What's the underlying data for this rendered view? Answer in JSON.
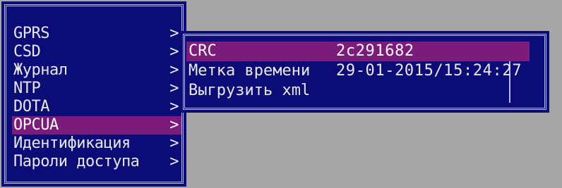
{
  "left_menu": {
    "items": [
      {
        "label": "GPRS",
        "arrow": ">"
      },
      {
        "label": "CSD",
        "arrow": ">"
      },
      {
        "label": "Журнал",
        "arrow": ">"
      },
      {
        "label": "NTP",
        "arrow": ">"
      },
      {
        "label": "DOTA",
        "arrow": ">"
      },
      {
        "label": "OPCUA",
        "arrow": ">"
      },
      {
        "label": "Идентификация",
        "arrow": ">"
      },
      {
        "label": "Пароли доступа",
        "arrow": ">"
      }
    ],
    "selected_index": 5
  },
  "right_menu": {
    "rows": [
      {
        "label": "CRC",
        "value": "2c291682"
      },
      {
        "label": "Метка времени",
        "value": "29-01-2015/15:24:27"
      },
      {
        "label": "Выгрузить xml",
        "value": ""
      }
    ],
    "selected_index": 0
  },
  "colors": {
    "panel_bg": "#0c0c78",
    "selection": "#7d1b7d",
    "border": "#b8b8ff",
    "screen_bg": "#a6a6a6",
    "text": "#e8e8e8"
  }
}
